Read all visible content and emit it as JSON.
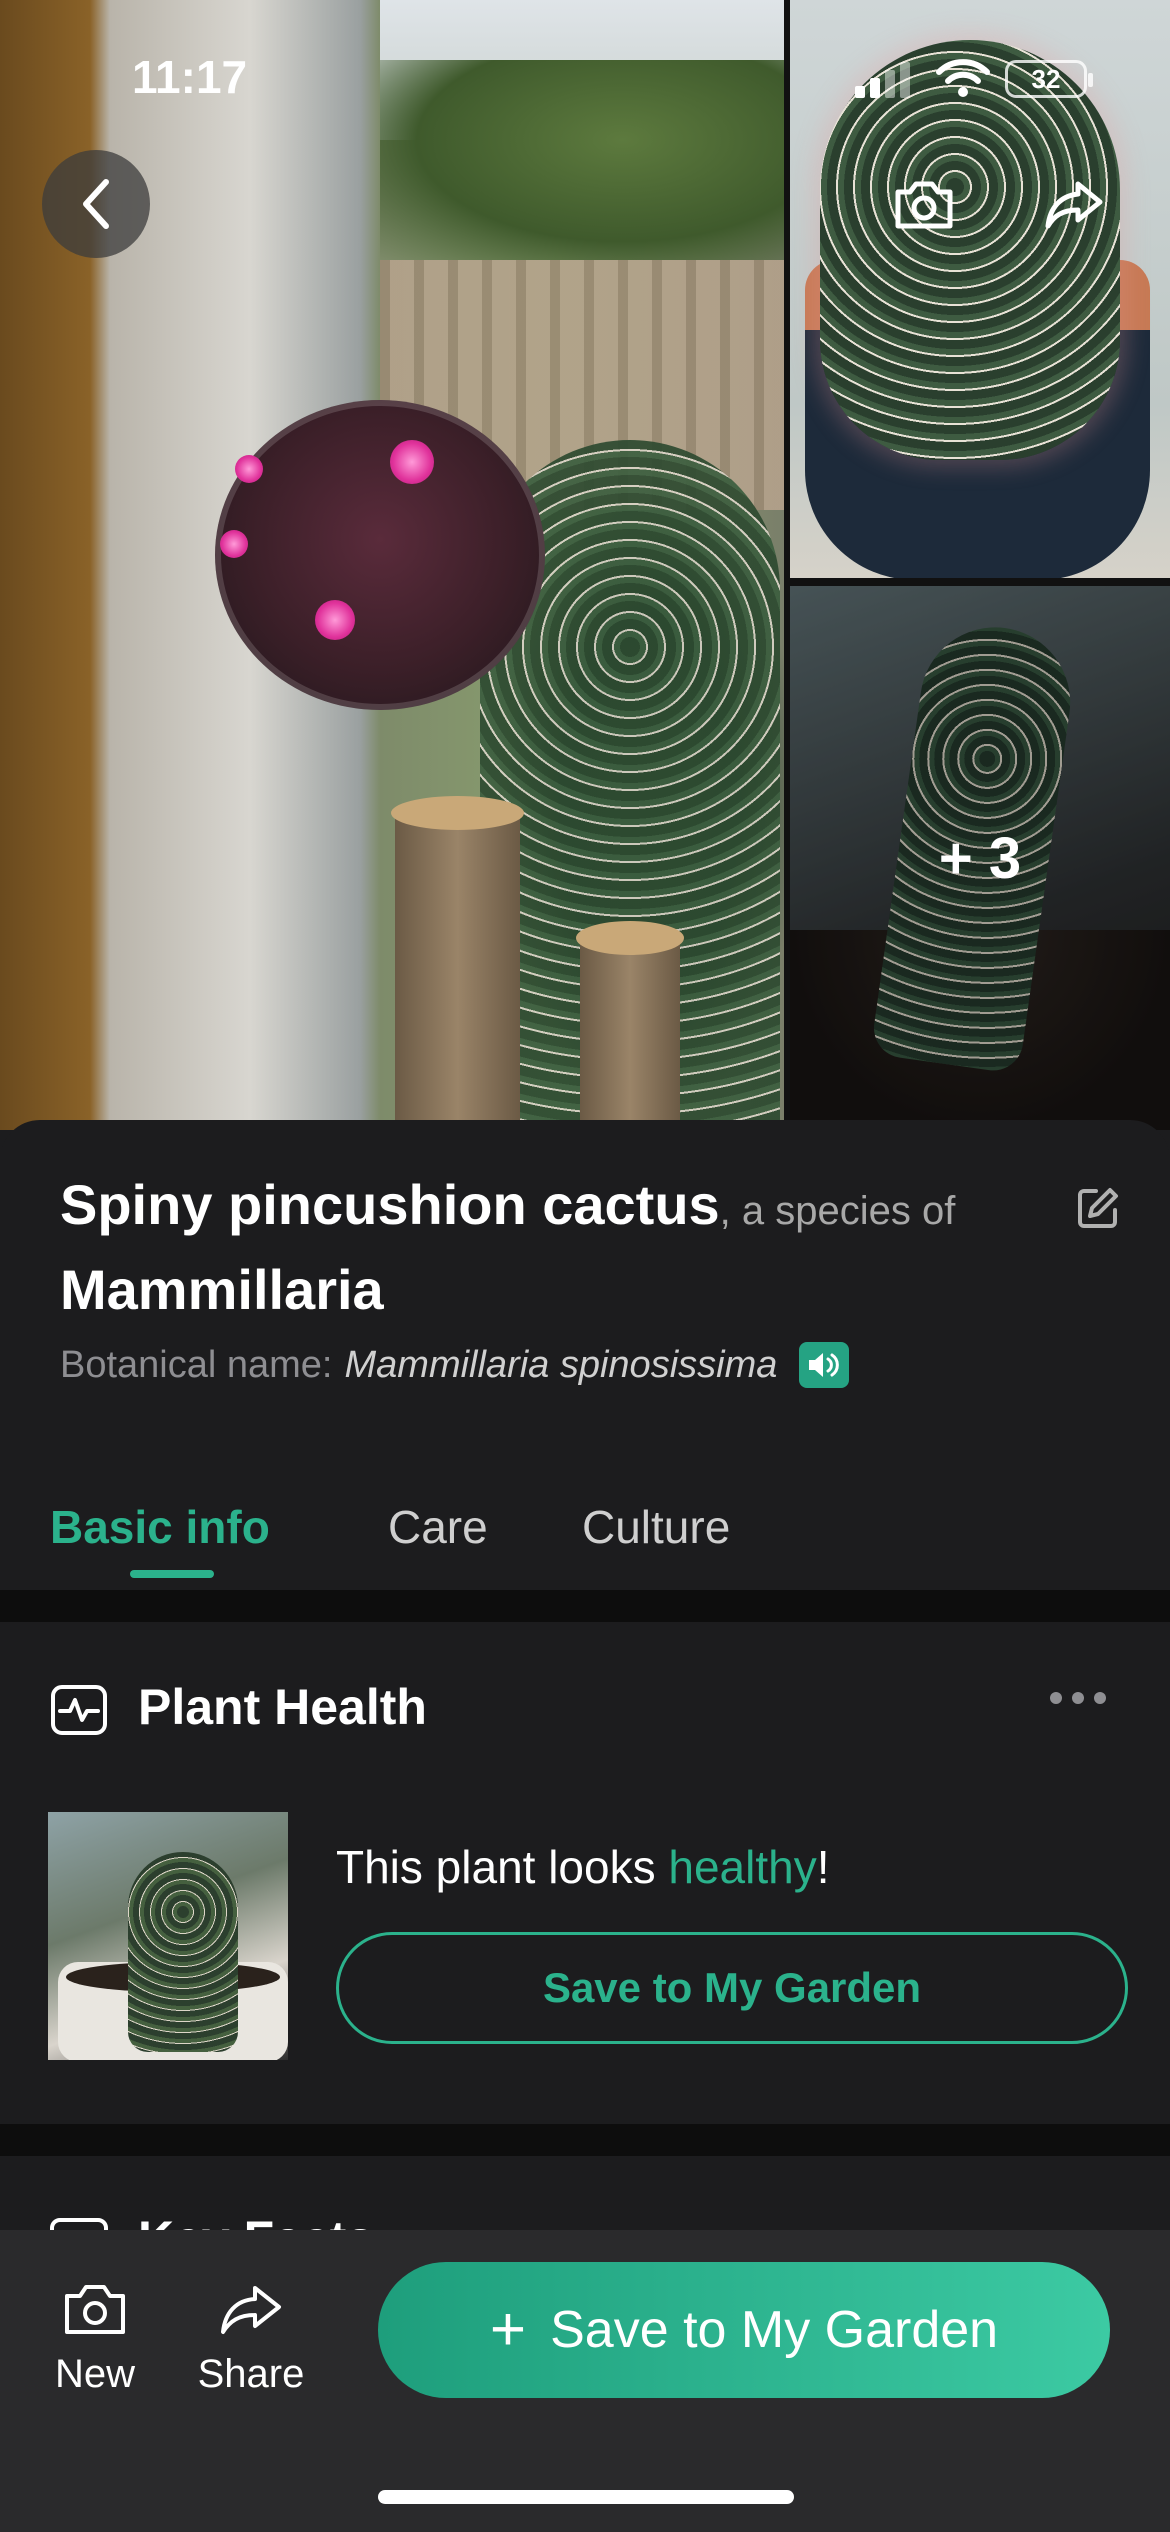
{
  "status_bar": {
    "time": "11:17",
    "battery": "32"
  },
  "gallery": {
    "more_photos_label": "+ 3",
    "icons": {
      "back": "back-chevron-icon",
      "camera": "camera-icon",
      "share": "share-arrow-icon"
    }
  },
  "plant": {
    "common_name": "Spiny pincushion cactus",
    "species_of_text": ", a species of",
    "genus": "Mammillaria",
    "botanical_label": "Botanical name:",
    "botanical_name": "Mammillaria spinosissima"
  },
  "tabs": [
    {
      "label": "Basic info",
      "active": true
    },
    {
      "label": "Care",
      "active": false
    },
    {
      "label": "Culture",
      "active": false
    }
  ],
  "health_card": {
    "title": "Plant Health",
    "status_prefix": "This plant looks ",
    "status_word": "healthy",
    "status_suffix": "!",
    "save_button": "Save to My Garden"
  },
  "next_card": {
    "title": "Key Facts"
  },
  "bottom_bar": {
    "new_label": "New",
    "share_label": "Share",
    "save_label": "Save to My Garden"
  },
  "colors": {
    "accent": "#2bb28c",
    "background": "#1c1c1e",
    "toolbar": "#2a2a2c"
  }
}
